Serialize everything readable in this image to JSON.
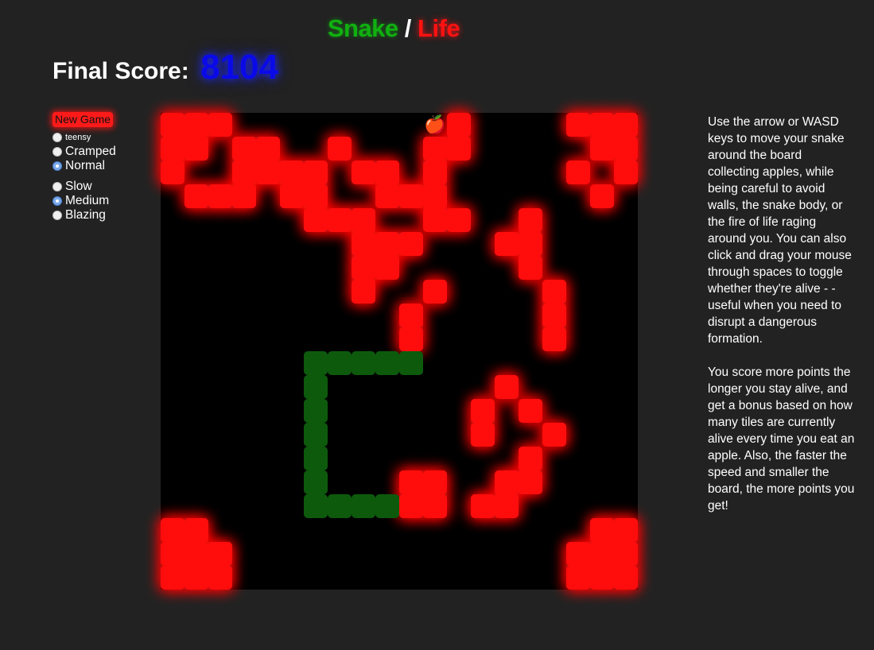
{
  "title": {
    "snake": "Snake",
    "separator": "/",
    "life": "Life"
  },
  "score": {
    "label": "Final Score:",
    "value": "8104"
  },
  "controls": {
    "new_game_label": "New Game",
    "sizes": [
      {
        "label": "teensy",
        "checked": false,
        "tiny": true
      },
      {
        "label": "Cramped",
        "checked": false
      },
      {
        "label": "Normal",
        "checked": true
      }
    ],
    "speeds": [
      {
        "label": "Slow",
        "checked": false
      },
      {
        "label": "Medium",
        "checked": true
      },
      {
        "label": "Blazing",
        "checked": false
      }
    ]
  },
  "board": {
    "columns": 20,
    "rows": 20,
    "colors": {
      "life": "#ff1010",
      "snake": "#0d5a0d",
      "background": "#000000"
    },
    "life_cells": [
      [
        0,
        0
      ],
      [
        1,
        0
      ],
      [
        2,
        0
      ],
      [
        12,
        0
      ],
      [
        17,
        0
      ],
      [
        18,
        0
      ],
      [
        19,
        0
      ],
      [
        0,
        1
      ],
      [
        1,
        1
      ],
      [
        3,
        1
      ],
      [
        4,
        1
      ],
      [
        7,
        1
      ],
      [
        11,
        1
      ],
      [
        12,
        1
      ],
      [
        18,
        1
      ],
      [
        19,
        1
      ],
      [
        0,
        2
      ],
      [
        3,
        2
      ],
      [
        4,
        2
      ],
      [
        5,
        2
      ],
      [
        6,
        2
      ],
      [
        8,
        2
      ],
      [
        9,
        2
      ],
      [
        11,
        2
      ],
      [
        17,
        2
      ],
      [
        19,
        2
      ],
      [
        1,
        3
      ],
      [
        2,
        3
      ],
      [
        3,
        3
      ],
      [
        5,
        3
      ],
      [
        6,
        3
      ],
      [
        9,
        3
      ],
      [
        10,
        3
      ],
      [
        11,
        3
      ],
      [
        18,
        3
      ],
      [
        6,
        4
      ],
      [
        7,
        4
      ],
      [
        8,
        4
      ],
      [
        11,
        4
      ],
      [
        12,
        4
      ],
      [
        15,
        4
      ],
      [
        8,
        5
      ],
      [
        9,
        5
      ],
      [
        10,
        5
      ],
      [
        14,
        5
      ],
      [
        15,
        5
      ],
      [
        8,
        6
      ],
      [
        9,
        6
      ],
      [
        15,
        6
      ],
      [
        8,
        7
      ],
      [
        11,
        7
      ],
      [
        16,
        7
      ],
      [
        10,
        8
      ],
      [
        16,
        8
      ],
      [
        10,
        9
      ],
      [
        16,
        9
      ],
      [
        14,
        11
      ],
      [
        13,
        12
      ],
      [
        15,
        12
      ],
      [
        13,
        13
      ],
      [
        16,
        13
      ],
      [
        15,
        14
      ],
      [
        10,
        15
      ],
      [
        11,
        15
      ],
      [
        14,
        15
      ],
      [
        15,
        15
      ],
      [
        10,
        16
      ],
      [
        11,
        16
      ],
      [
        13,
        16
      ],
      [
        14,
        16
      ],
      [
        0,
        17
      ],
      [
        1,
        17
      ],
      [
        18,
        17
      ],
      [
        19,
        17
      ],
      [
        0,
        18
      ],
      [
        1,
        18
      ],
      [
        2,
        18
      ],
      [
        17,
        18
      ],
      [
        18,
        18
      ],
      [
        19,
        18
      ],
      [
        0,
        19
      ],
      [
        1,
        19
      ],
      [
        2,
        19
      ],
      [
        17,
        19
      ],
      [
        18,
        19
      ],
      [
        19,
        19
      ]
    ],
    "snake_cells": [
      [
        6,
        10
      ],
      [
        7,
        10
      ],
      [
        8,
        10
      ],
      [
        9,
        10
      ],
      [
        10,
        10
      ],
      [
        6,
        11
      ],
      [
        6,
        12
      ],
      [
        6,
        13
      ],
      [
        6,
        14
      ],
      [
        6,
        15
      ],
      [
        6,
        16
      ],
      [
        7,
        16
      ],
      [
        8,
        16
      ],
      [
        9,
        16
      ]
    ],
    "apple": {
      "cell": [
        11,
        0
      ],
      "icon": "apple-icon",
      "glyph": "🍎"
    }
  },
  "instructions": [
    "Use the arrow or WASD keys to move your snake around the board collecting apples, while being careful to avoid walls, the snake body, or the fire of life raging around you. You can also click and drag your mouse through spaces to toggle whether they're alive - - useful when you need to disrupt a dangerous formation.",
    "You score more points the longer you stay alive, and get a bonus based on how many tiles are currently alive every time you eat an apple. Also, the faster the speed and smaller the board, the more points you get!"
  ]
}
